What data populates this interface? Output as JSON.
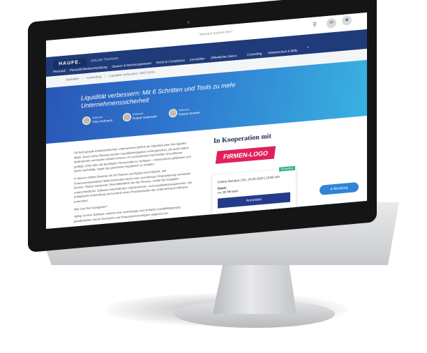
{
  "topbar": {
    "search_placeholder": "Wonach suchen Sie?",
    "search_icon": "magnifier",
    "icons": [
      "chat-icon",
      "user-icon"
    ]
  },
  "nav": {
    "logo": "HAUFE.",
    "section_label": "ONLINE-TRAINING",
    "items": [
      "Personal",
      "Persönlichkeitsentwicklung",
      "Steuern & Rechnungswesen",
      "Recht & Compliance",
      "Immobilien",
      "Öffentlicher Dienst",
      "Controlling",
      "Arbeitsschutz & Bildu"
    ]
  },
  "breadcrumb": [
    "Startseite",
    "Controlling",
    "Liquidität verbessern: Mit 6 Schri..."
  ],
  "hero": {
    "title": "Liquidität verbessern: Mit 6 Schritten und Tools zu mehr Unternehmenssicherheit",
    "referents": [
      {
        "label": "Referent",
        "name": "Timo Hofmann"
      },
      {
        "label": "Referent",
        "name": "Robert Gebersdrr"
      },
      {
        "label": "Referent",
        "name": "Patrick Sentrek"
      }
    ]
  },
  "body": {
    "paragraphs": [
      "Oft fehlt gerade mittelständischen Unternehmen (KMU) der Überblick über ihre liquiden Mittel. Durch frühe Planung werden Liquiditätsengpässe vorhergesehen, die durch aktive Maßnahmen vermieden werden können. Im schlechtesten Fall werden Investitionen getätigt, ohne über die benötigten Finanzmittel zu verfügen – Unternehmen gefährden sich damit nachhaltig, sogar das gesicherte Hauptwerk zu erhalten.",
      "In diesem Online-Seminar mit Ihr Finance und Agilop wird erläutert, wie Finanzverantwortliche Mittel Anwenden durch eine zuverlässige Finanzplanung vermeiden können. Robert Gebersdrr, Geschäftsführer bei der Finance, erklärt die Aufgaben unterschiedlicher Software innerhalb des Unternehmens- und Liquiditätsmanagements. Die erfolgreiche Anwendung wird anhand eines Praxisbeispiels des Unternehmens Adholnet unterstützt.",
      "Wer sind Ihre Gastgeber?",
      "Agilop ist eine Software, welche eine zuverlässige und einfache Liquiditätsplanung gewährleistet. Durch Szenarien und Prognosetechnologien aufgrund von"
    ]
  },
  "sidebar": {
    "cooperation_title": "In Kooperation mit",
    "partner_logo": "FIRMEN-LOGO",
    "badge": "Kostenfrei",
    "event_line": "Online-Seminar | Do, 24.03.2022 | 10:00 Uhr",
    "duration_label": "Dauer",
    "duration_value": "ca. 90 Minuten",
    "register_label": "Anmelden"
  },
  "consult_label": "Beratung"
}
